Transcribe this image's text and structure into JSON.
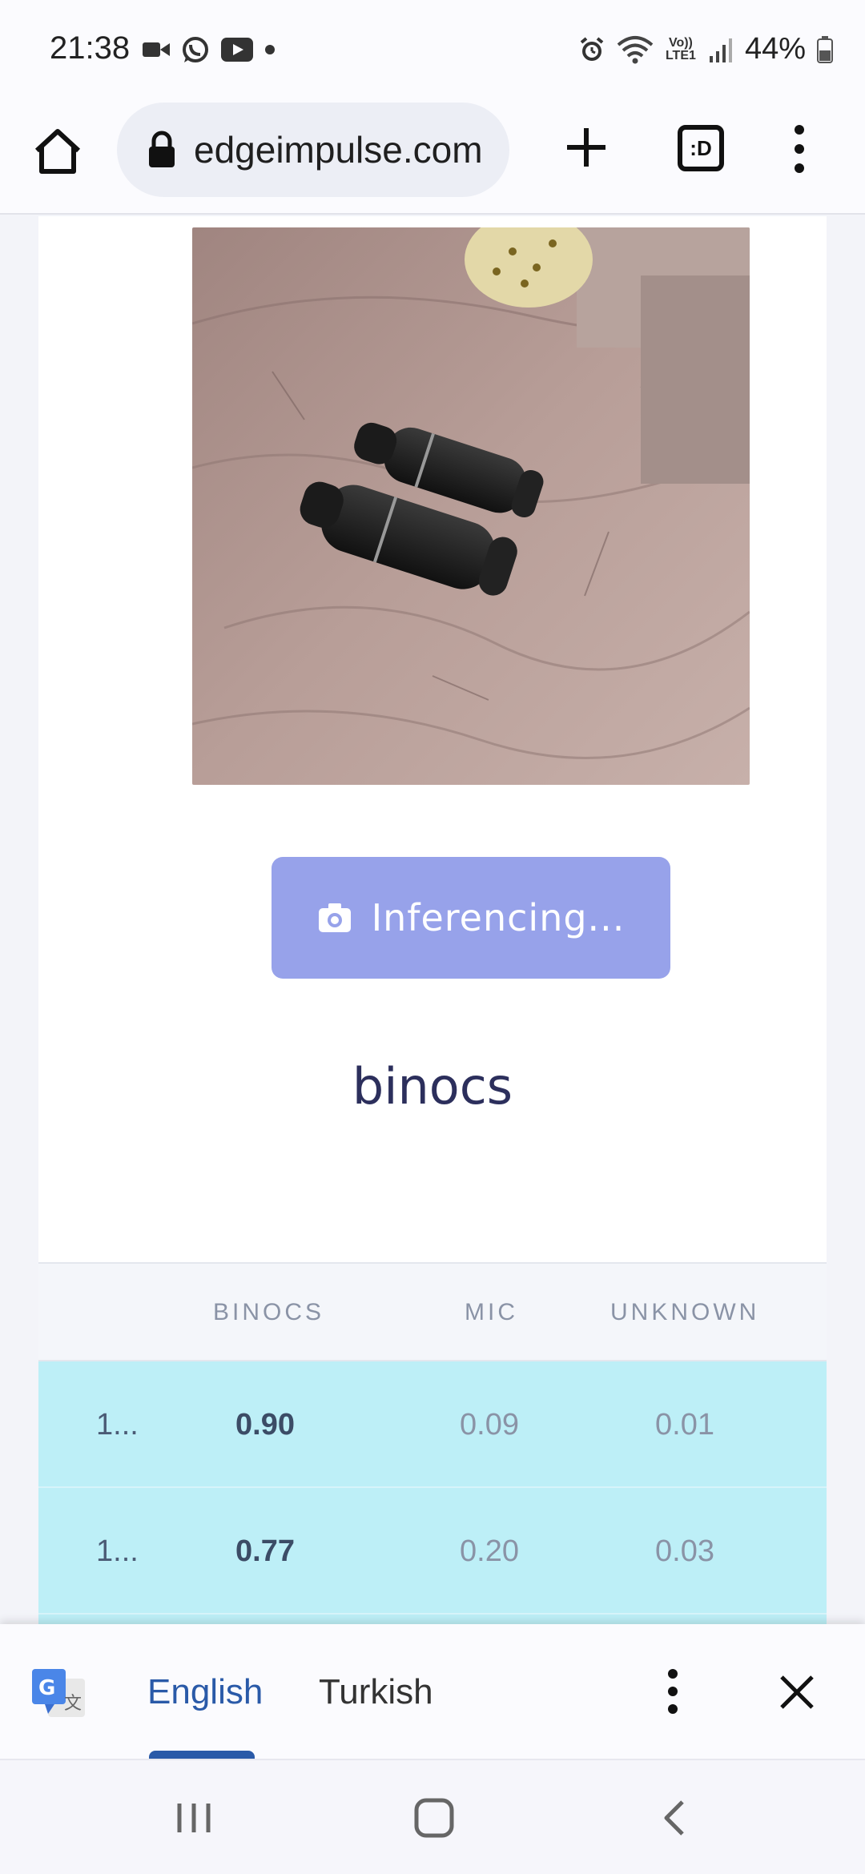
{
  "status_bar": {
    "time": "21:38",
    "left_icons": [
      "video-call-icon",
      "whatsapp-icon",
      "youtube-icon",
      "dot-icon"
    ],
    "right_icons": [
      "alarm-icon",
      "wifi-icon",
      "volte-icon",
      "signal-icon",
      "battery-icon"
    ],
    "volte_label": "Vo)) LTE1",
    "battery": "44%"
  },
  "browser": {
    "url": "edgeimpulse.com",
    "tab_switcher_label": ":D"
  },
  "main": {
    "photo_subject": "binoculars-photo",
    "inference_button_label": "Inferencing...",
    "result_title": "binocs"
  },
  "results_table": {
    "columns": [
      "",
      "BINOCS",
      "MIC",
      "UNKNOWN"
    ],
    "rows": [
      {
        "index": "1...",
        "binocs": "0.90",
        "mic": "0.09",
        "unknown": "0.01"
      },
      {
        "index": "1...",
        "binocs": "0.77",
        "mic": "0.20",
        "unknown": "0.03"
      }
    ]
  },
  "translate_bar": {
    "source_language": "English",
    "target_language": "Turkish"
  },
  "colors": {
    "accent_button": "#97a2ea",
    "row_highlight": "#bdeff7",
    "title_text": "#2c2f5c",
    "translate_active": "#2a5aa8"
  }
}
